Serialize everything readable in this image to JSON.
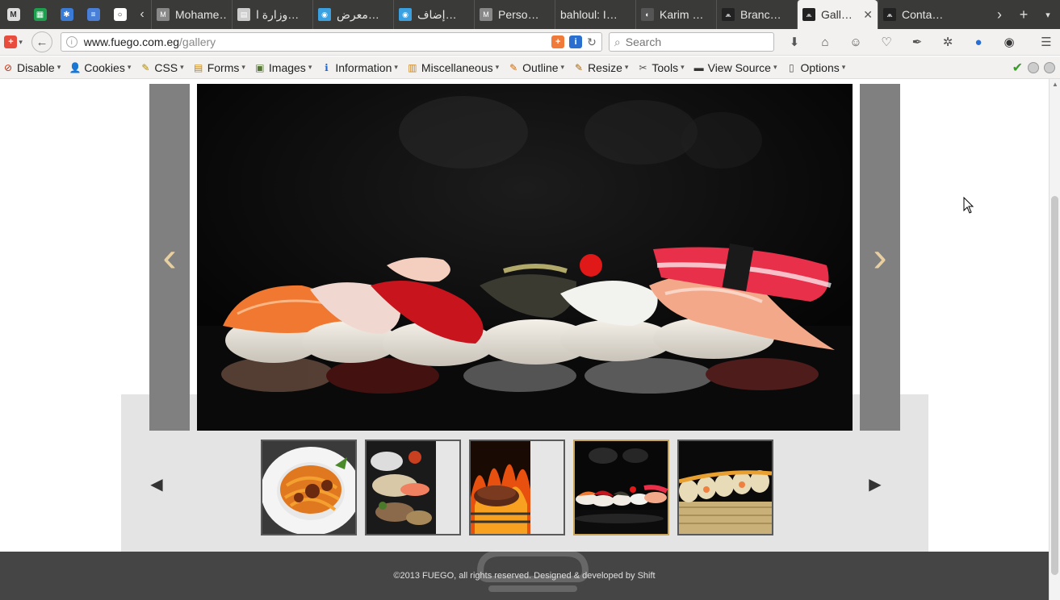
{
  "browser": {
    "pinned_tabs": [
      {
        "icon": "gmail-icon",
        "color": "#dddddd",
        "glyph": "M"
      },
      {
        "icon": "sheets-icon",
        "color": "#1e9e4f",
        "glyph": "▦"
      },
      {
        "icon": "snowflake-icon",
        "color": "#3a7bd5",
        "glyph": "✱"
      },
      {
        "icon": "docs-icon",
        "color": "#4a7fd8",
        "glyph": "≡"
      },
      {
        "icon": "olx-icon",
        "color": "#ffffff",
        "glyph": "○"
      }
    ],
    "tabs": [
      {
        "label": "Mohame…",
        "icon": "gmail-icon",
        "color": "#888888",
        "glyph": "M"
      },
      {
        "label": "وزارة ا…",
        "icon": "document-icon",
        "color": "#cccccc",
        "glyph": "▤"
      },
      {
        "label": "معرض…",
        "icon": "circle-app-icon",
        "color": "#3aa0e0",
        "glyph": "◉"
      },
      {
        "label": "إضاف…",
        "icon": "circle-app-icon",
        "color": "#3aa0e0",
        "glyph": "◉"
      },
      {
        "label": "Perso…",
        "icon": "gmail-icon",
        "color": "#888888",
        "glyph": "M"
      },
      {
        "label": "bahloul: I…",
        "icon": "",
        "color": "",
        "glyph": ""
      },
      {
        "label": "Karim …",
        "icon": "github-icon",
        "color": "#555555",
        "glyph": "◐"
      },
      {
        "label": "Branc…",
        "icon": "fuego-logo-icon",
        "color": "#222222",
        "glyph": "⩕"
      },
      {
        "label": "Gall…",
        "icon": "fuego-logo-icon",
        "color": "#222222",
        "glyph": "⩕",
        "active": true
      },
      {
        "label": "Conta…",
        "icon": "fuego-logo-icon",
        "color": "#222222",
        "glyph": "⩕"
      }
    ],
    "new_tab": "+",
    "url_domain": "www.fuego.com.eg",
    "url_path": "/gallery",
    "search_placeholder": "Search"
  },
  "devbar": {
    "items": [
      {
        "label": "Disable",
        "icon": "disable-icon",
        "glyph": "⊘",
        "color": "#cc2200"
      },
      {
        "label": "Cookies",
        "icon": "cookies-icon",
        "glyph": "👤",
        "color": "#333333"
      },
      {
        "label": "CSS",
        "icon": "css-icon",
        "glyph": "✎",
        "color": "#aa8800"
      },
      {
        "label": "Forms",
        "icon": "forms-icon",
        "glyph": "▤",
        "color": "#cc8800"
      },
      {
        "label": "Images",
        "icon": "images-icon",
        "glyph": "▣",
        "color": "#557733"
      },
      {
        "label": "Information",
        "icon": "information-icon",
        "glyph": "ℹ",
        "color": "#2266cc"
      },
      {
        "label": "Miscellaneous",
        "icon": "miscellaneous-icon",
        "glyph": "▥",
        "color": "#cc8822"
      },
      {
        "label": "Outline",
        "icon": "outline-icon",
        "glyph": "✎",
        "color": "#cc6600"
      },
      {
        "label": "Resize",
        "icon": "resize-icon",
        "glyph": "✎",
        "color": "#aa6600"
      },
      {
        "label": "Tools",
        "icon": "tools-icon",
        "glyph": "✂",
        "color": "#555555"
      },
      {
        "label": "View Source",
        "icon": "view-source-icon",
        "glyph": "▬",
        "color": "#333333"
      },
      {
        "label": "Options",
        "icon": "options-icon",
        "glyph": "▯",
        "color": "#555555"
      }
    ]
  },
  "gallery": {
    "prev_arrow": "‹",
    "next_arrow": "›",
    "thumb_prev": "◀",
    "thumb_next": "▶",
    "thumbnails": [
      {
        "name": "thumb-pasta",
        "active": false
      },
      {
        "name": "thumb-sushi-platter",
        "active": false
      },
      {
        "name": "thumb-grill-steak",
        "active": false
      },
      {
        "name": "thumb-nigiri",
        "active": true
      },
      {
        "name": "thumb-sushi-rolls",
        "active": false
      }
    ]
  },
  "footer": {
    "copyright": "©2013 FUEGO, all rights reserved. Designed & developed by Shift"
  },
  "colors": {
    "accent_gold": "#c9a55a",
    "arrow_cream": "#e8cfa0",
    "footer_bg": "#454545",
    "panel_gray": "#e4e4e4"
  }
}
